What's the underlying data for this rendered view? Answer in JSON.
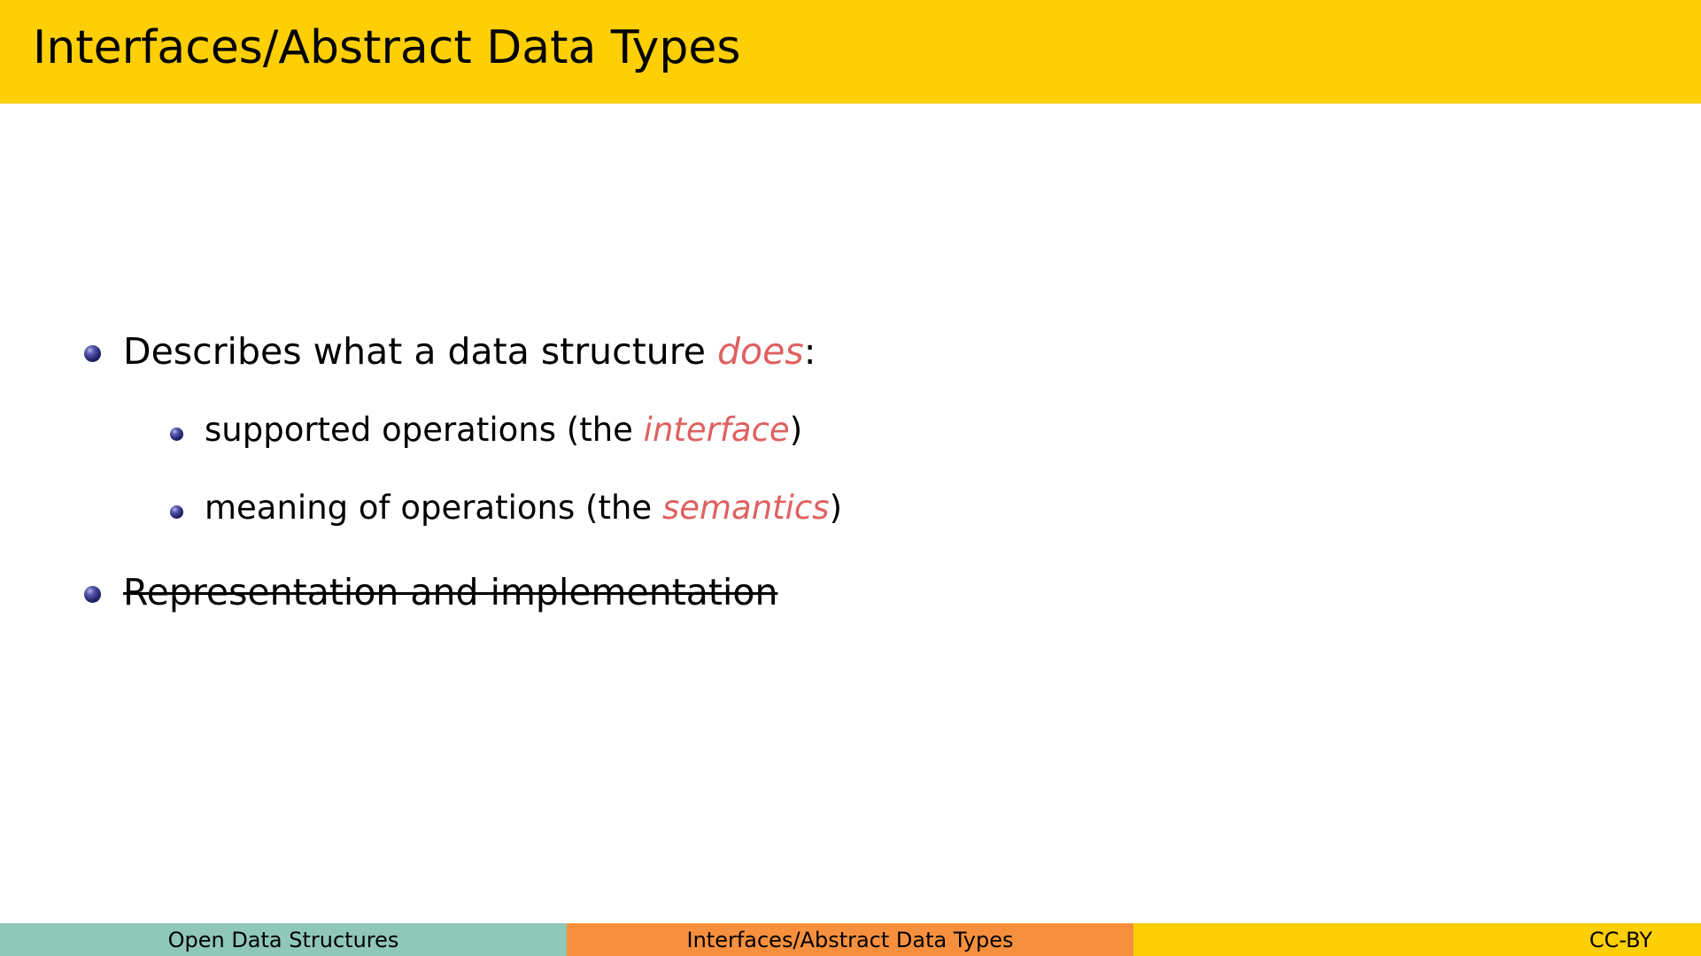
{
  "slide": {
    "title": "Interfaces/Abstract Data Types"
  },
  "bullets": [
    {
      "text_before": "Describes what a data structure ",
      "emphasis": "does",
      "text_after": ":",
      "sub": [
        {
          "text_before": "supported operations (the ",
          "emphasis": "interface",
          "text_after": ")"
        },
        {
          "text_before": "meaning of operations (the ",
          "emphasis": "semantics",
          "text_after": ")"
        }
      ]
    },
    {
      "text": "Representation and implementation",
      "struck_through": true
    }
  ],
  "footer": {
    "left": "Open Data Structures",
    "center": "Interfaces/Abstract Data Types",
    "right": "CC-BY"
  },
  "colors": {
    "header": "#FFCF05",
    "emphasis": "#E06060",
    "footer_left": "#8FC7B8",
    "footer_center": "#F7903E",
    "footer_right": "#FFCF05"
  }
}
